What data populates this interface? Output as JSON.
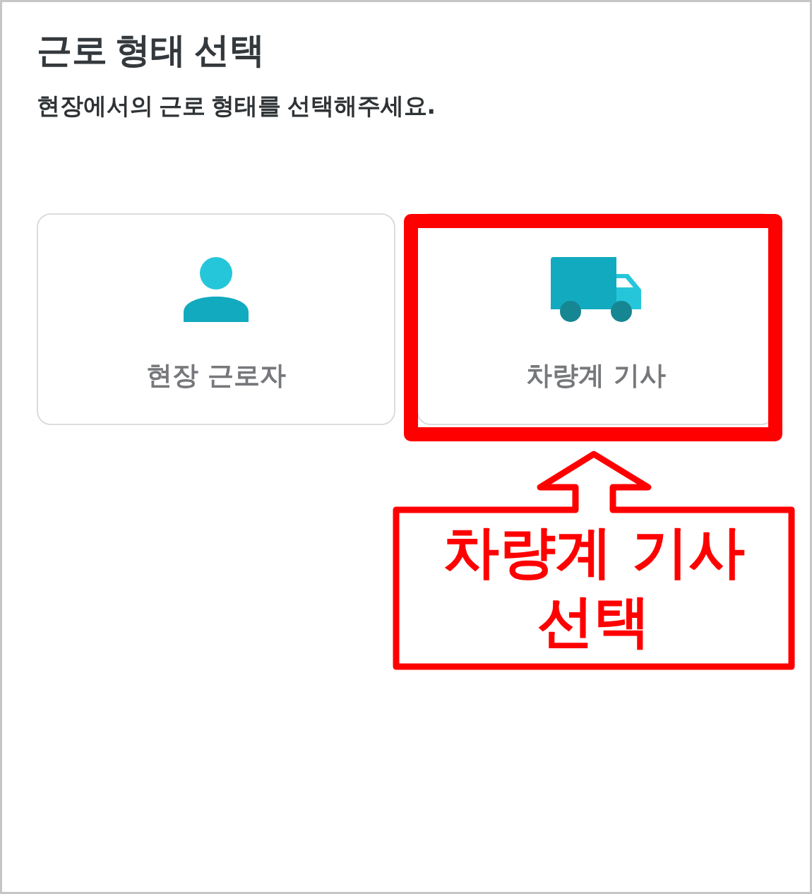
{
  "header": {
    "title": "근로 형태 선택",
    "subtitle": "현장에서의 근로 형태를 선택해주세요."
  },
  "options": [
    {
      "kind": "person",
      "label": "현장 근로자",
      "highlighted": false
    },
    {
      "kind": "truck",
      "label": "차량계 기사",
      "highlighted": true
    }
  ],
  "annotation": {
    "text": "차량계 기사 선택"
  }
}
